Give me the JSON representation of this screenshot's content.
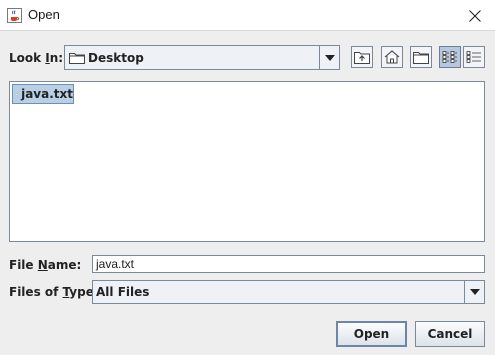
{
  "window": {
    "title": "Open",
    "icon": "java-cup-icon",
    "close_icon": "close-icon"
  },
  "look_in": {
    "label_prefix": "Look ",
    "label_mnemonic": "I",
    "label_suffix": "n:",
    "value": "Desktop",
    "icon": "folder-icon"
  },
  "toolbar": {
    "buttons": [
      {
        "name": "up-one-level-icon"
      },
      {
        "name": "home-icon"
      },
      {
        "name": "new-folder-icon"
      },
      {
        "name": "list-view-icon",
        "active": true
      },
      {
        "name": "details-view-icon"
      }
    ]
  },
  "file_list": {
    "items": [
      {
        "name": "java.txt",
        "icon": "file-icon",
        "selected": true
      }
    ]
  },
  "file_name": {
    "label_prefix": "File ",
    "label_mnemonic": "N",
    "label_suffix": "ame:",
    "value": "java.txt"
  },
  "file_type": {
    "label_prefix": "Files of ",
    "label_mnemonic": "T",
    "label_suffix": "ype:",
    "value": "All Files"
  },
  "buttons": {
    "open": "Open",
    "cancel": "Cancel"
  },
  "colors": {
    "selection": "#b8cfe5",
    "border": "#7a8a99",
    "background": "#eeeeee"
  }
}
